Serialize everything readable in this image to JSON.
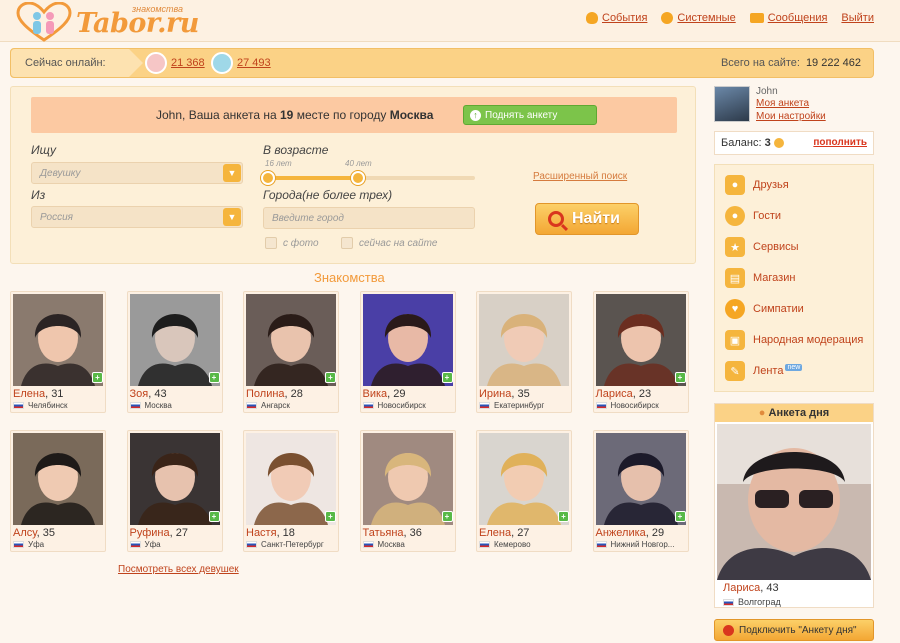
{
  "header": {
    "logo_sub": "знакомства",
    "logo_text": "Tabor.ru",
    "nav": [
      {
        "label": "События",
        "icon": "flame-icon",
        "color": "#f5a623"
      },
      {
        "label": "Системные",
        "icon": "info-icon",
        "color": "#f5a623"
      },
      {
        "label": "Сообщения",
        "icon": "envelope-icon",
        "color": "#f5a623"
      },
      {
        "label": "Выйти",
        "icon": "",
        "color": ""
      }
    ]
  },
  "online": {
    "label": "Сейчас онлайн:",
    "female_count": "21 368",
    "male_count": "27 493",
    "total_label": "Всего на сайте:",
    "total_value": "19 222 462"
  },
  "rank": {
    "prefix": "John, Ваша анкета на",
    "place": "19",
    "middle": "месте по городу",
    "city": "Москва",
    "raise_button": "Поднять анкету"
  },
  "search": {
    "looking_label": "Ищу",
    "looking_value": "Девушку",
    "from_label": "Из",
    "from_value": "Россия",
    "age_label": "В возрасте",
    "age_min": "16 лет",
    "age_max": "40 лет",
    "age_min_value": 16,
    "age_max_value": 40,
    "cities_label": "Города(не более трех)",
    "city_placeholder": "Введите город",
    "with_photo": "с фото",
    "online_now": "сейчас на сайте",
    "advanced": "Расширенный поиск",
    "find_button": "Найти"
  },
  "section_title": "Знакомства",
  "profiles": [
    {
      "name": "Елена",
      "age": ", 31",
      "city": "Челябинск",
      "online": true
    },
    {
      "name": "Зоя",
      "age": ", 43",
      "city": "Москва",
      "online": true
    },
    {
      "name": "Полина",
      "age": ", 28",
      "city": "Ангарск",
      "online": true
    },
    {
      "name": "Вика",
      "age": ", 29",
      "city": "Новосибирск",
      "online": true
    },
    {
      "name": "Ирина",
      "age": ", 35",
      "city": "Екатеринбург",
      "online": false
    },
    {
      "name": "Лариса",
      "age": ", 23",
      "city": "Новосибирск",
      "online": true
    },
    {
      "name": "Алсу",
      "age": ", 35",
      "city": "Уфа",
      "online": false
    },
    {
      "name": "Руфина",
      "age": ", 27",
      "city": "Уфа",
      "online": true
    },
    {
      "name": "Настя",
      "age": ", 18",
      "city": "Санкт-Петербург",
      "online": true
    },
    {
      "name": "Татьяна",
      "age": ", 36",
      "city": "Москва",
      "online": true
    },
    {
      "name": "Елена",
      "age": ", 27",
      "city": "Кемерово",
      "online": true
    },
    {
      "name": "Анжелика",
      "age": ", 29",
      "city": "Нижний Новгор...",
      "online": true
    }
  ],
  "see_all": "Посмотреть всех девушек",
  "user": {
    "name": "John",
    "my_profile": "Моя анкета",
    "my_settings": "Мои настройки",
    "balance_label": "Баланс:",
    "balance_value": "3",
    "topup": "пополнить"
  },
  "menu": [
    {
      "label": "Друзья",
      "icon": "friends-icon"
    },
    {
      "label": "Гости",
      "icon": "guests-icon"
    },
    {
      "label": "Сервисы",
      "icon": "star-icon"
    },
    {
      "label": "Магазин",
      "icon": "basket-icon"
    },
    {
      "label": "Симпатии",
      "icon": "heart-icon"
    },
    {
      "label": "Народная модерация",
      "icon": "moderation-icon"
    },
    {
      "label": "Лента",
      "icon": "feed-icon"
    }
  ],
  "feed_badge": "new",
  "profile_of_day": {
    "title": "Анкета дня",
    "name": "Лариса",
    "age": ", 43",
    "city": "Волгоград",
    "connect_button": "Подключить \"Анкету дня\""
  },
  "colors": {
    "accent": "#f29a3b",
    "link": "#c0431c",
    "online_green": "#58b947"
  }
}
